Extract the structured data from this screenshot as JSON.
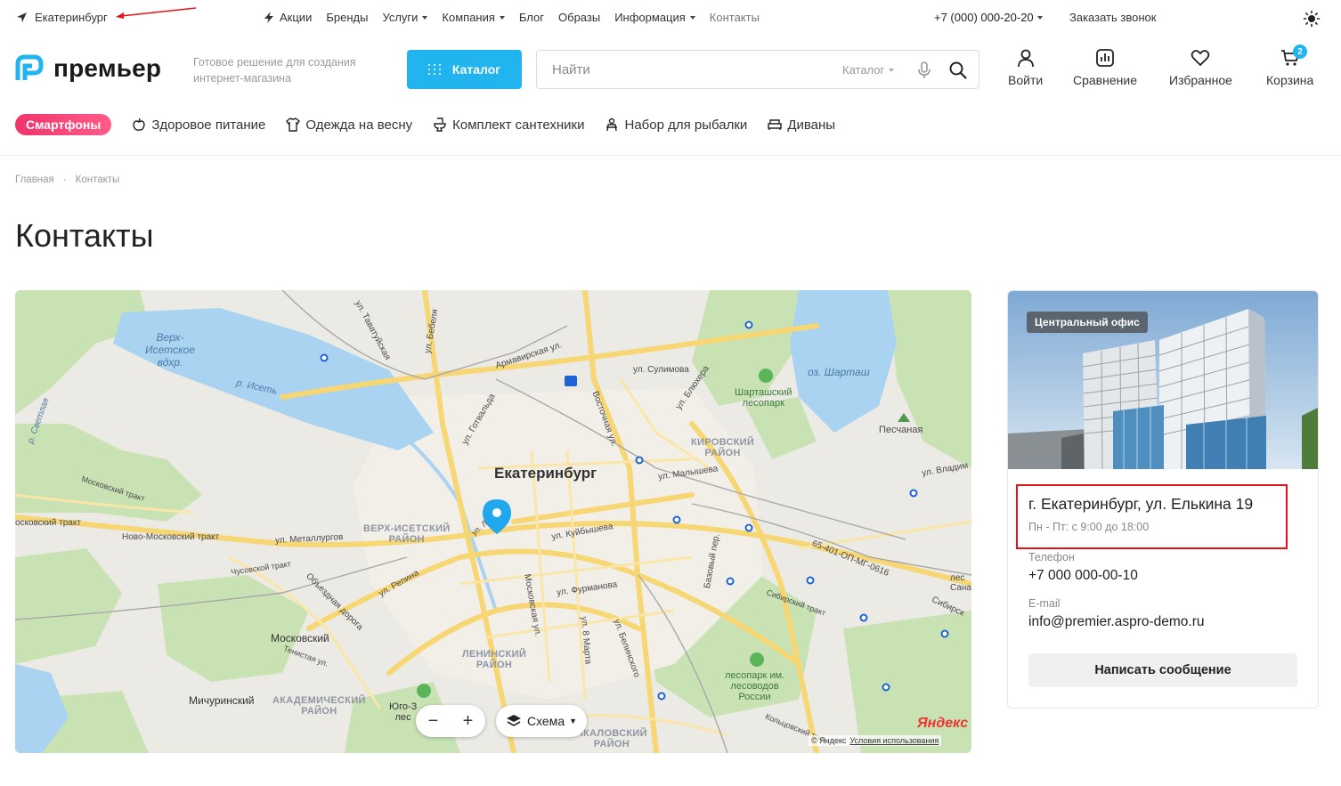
{
  "topbar": {
    "city": "Екатеринбург",
    "nav": [
      {
        "label": "Акции",
        "icon": "bolt-icon",
        "dropdown": false
      },
      {
        "label": "Бренды",
        "dropdown": false
      },
      {
        "label": "Услуги",
        "dropdown": true
      },
      {
        "label": "Компания",
        "dropdown": true
      },
      {
        "label": "Блог",
        "dropdown": false
      },
      {
        "label": "Образы",
        "dropdown": false
      },
      {
        "label": "Информация",
        "dropdown": true
      },
      {
        "label": "Контакты",
        "dropdown": false,
        "active": true
      }
    ],
    "phone": "+7 (000) 000-20-20",
    "callback": "Заказать звонок"
  },
  "header": {
    "logo": "премьер",
    "tagline": "Готовое решение для создания интернет-магазина",
    "catalog_button": "Каталог",
    "search": {
      "placeholder": "Найти",
      "scope": "Каталог"
    },
    "actions": {
      "login": "Войти",
      "compare": "Сравнение",
      "favorites": "Избранное",
      "cart": "Корзина",
      "cart_count": "2"
    }
  },
  "categories": {
    "featured": "Смартфоны",
    "items": [
      "Здоровое питание",
      "Одежда на весну",
      "Комплект сантехники",
      "Набор для рыбалки",
      "Диваны"
    ]
  },
  "breadcrumb": {
    "home": "Главная",
    "current": "Контакты"
  },
  "page_title": "Контакты",
  "map": {
    "city": "Екатеринбург",
    "labels": {
      "verkh_isetskoe": "Верх-\nИсетское\nвдхр.",
      "iset": "р. Исеть",
      "shartash": "оз. Шарташ",
      "shartash_park": "Шарташский\nлесопарк",
      "peschanaya": "Песчаная",
      "kirovsky": "КИРОВСКИЙ\nРАЙОН",
      "verkh_isetsky": "ВЕРХ-ИСЕТСКИЙ\nРАЙОН",
      "leninsky": "ЛЕНИНСКИЙ\nРАЙОН",
      "akademichesky": "АКАДЕМИЧЕСКИЙ\nРАЙОН",
      "chkalovsky": "ЧКАЛОВСКИЙ\nРАЙОН",
      "moskovsky": "Московский",
      "michurinsky": "Мичуринский",
      "lesopark_lesovodov": "лесопарк им.\nлесоводов\nРоссии",
      "yugo": "Юго-З\nлес",
      "tavatuyskaya": "ул. Таватуйская",
      "bebelya": "ул. Бебеля",
      "armavirskaya": "Армавирская ул.",
      "sulimova": "ул. Сулимова",
      "blyukhera": "ул. Блюхера",
      "vostochnaya": "Восточная ул.",
      "gotvalda": "ул. Готвальда",
      "malysheva": "ул. Малышева",
      "kuybysheva": "ул. Куйбышева",
      "metallurgov": "ул. Металлургов",
      "novo_mosk": "Ново-Московский тракт",
      "moskovsky_trakt": "Московский тракт",
      "chusovskoy": "Чусовской тракт",
      "repina": "ул. Репина",
      "obezdnaya": "Объездная дорога",
      "tenistaya": "Тенистая ул.",
      "moskovskaya": "Московская ул.",
      "furmanova": "ул. Фурманова",
      "8marta": "ул. 8 Марта",
      "belinskogo": "ул. Белинского",
      "bazovy": "Базовый пер.",
      "sibirsky": "Сибирский тракт",
      "sibirsky2": "Сибирск",
      "kolcovsky": "Кольцовский тракт",
      "highway": "65-401-ОП-МГ-0616",
      "vladim": "ул. Владим",
      "svetlaya": "р. Светлая",
      "ul_l": "ул. Л",
      "les_sana": "лес\nСана",
      "okskoy": "осковский тракт",
      "yandex": "Яндекс"
    },
    "controls": {
      "layer": "Схема"
    },
    "copyright": "© Яндекс",
    "terms": "Условия использования"
  },
  "office": {
    "tag": "Центральный офис",
    "address": "г. Екатеринбург, ул. Елькина 19",
    "hours": "Пн - Пт: с 9:00 до 18:00",
    "phone_label": "Телефон",
    "phone": "+7 000 000-00-10",
    "email_label": "E-mail",
    "email": "info@premier.aspro-demo.ru",
    "message_button": "Написать сообщение"
  },
  "colors": {
    "accent": "#21b4ee",
    "highlight": "#e0151c",
    "pill": "#f0346b"
  }
}
